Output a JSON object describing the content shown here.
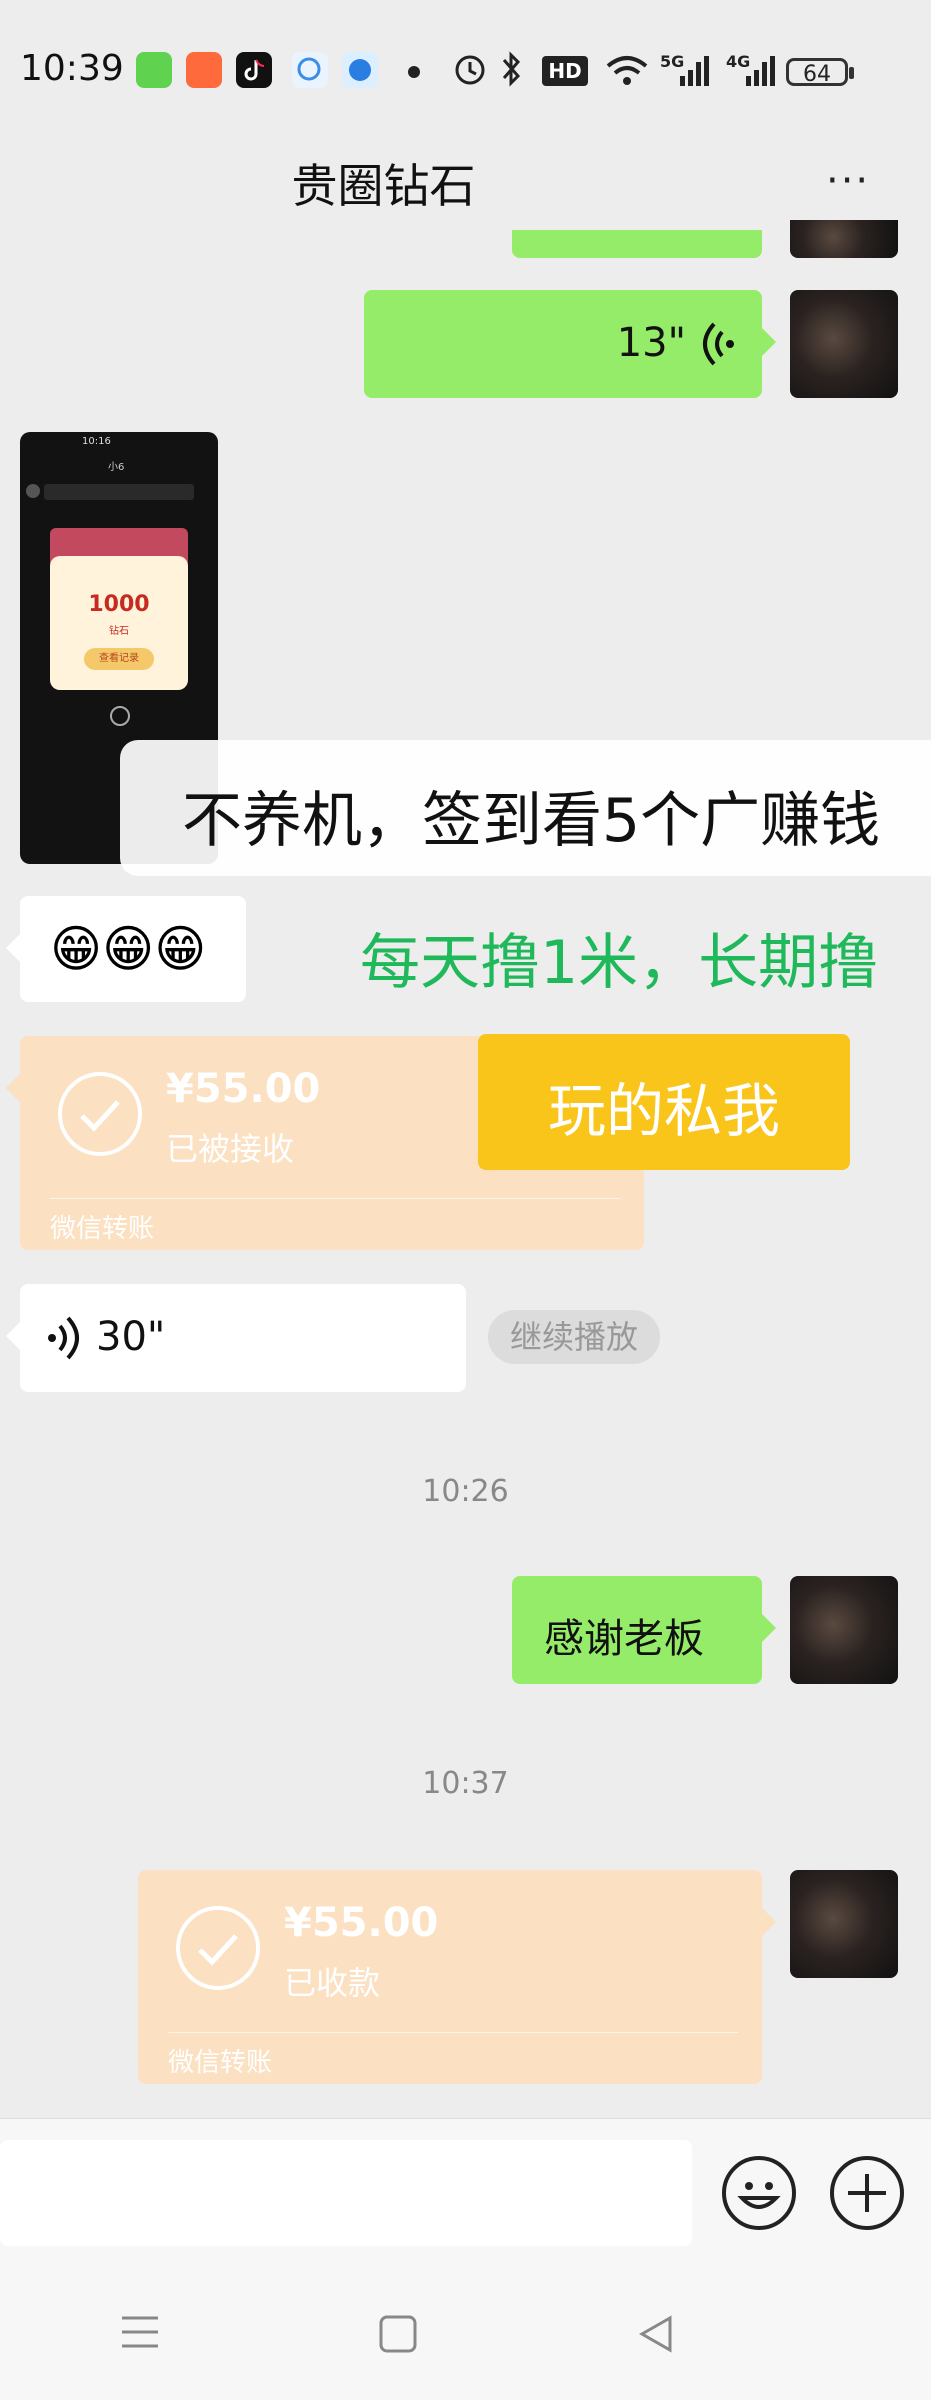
{
  "status_bar": {
    "time": "10:39",
    "battery": "64",
    "hd_label": "HD",
    "net_5g": "5G",
    "net_4g": "4G",
    "icons": [
      "messages-app-icon",
      "shopping-app-icon",
      "tiktok-app-icon",
      "chat-app-icon",
      "browser-app-icon",
      "notification-dot",
      "alarm-icon",
      "bluetooth-icon",
      "hd-voice-icon",
      "wifi-icon",
      "signal-5g-icon",
      "signal-4g-icon",
      "battery-icon"
    ]
  },
  "header": {
    "title": "贵圈钻石",
    "more_label": "···"
  },
  "messages": {
    "voice_sent": {
      "duration": "13\""
    },
    "screenshot_preview": {
      "time": "10:16",
      "top_text": "小6",
      "amount": "1000",
      "unit": "钻石",
      "button": "查看记录"
    },
    "overlay_white": "不养机，签到看5个广赚钱",
    "emoji_message": "😁😁😁",
    "overlay_green": "每天撸1米，长期撸",
    "transfer_received": {
      "amount": "¥55.00",
      "status": "已被接收",
      "footer": "微信转账"
    },
    "overlay_yellow": "玩的私我",
    "voice_received": {
      "duration": "30\"",
      "continue_label": "继续播放"
    },
    "time_1": "10:26",
    "thanks_message": "感谢老板",
    "time_2": "10:37",
    "transfer_sent": {
      "amount": "¥55.00",
      "status": "已收款",
      "footer": "微信转账"
    }
  },
  "input_bar": {
    "placeholder": ""
  },
  "colors": {
    "background": "#ededed",
    "bubble_green": "#95ec69",
    "transfer_orange": "#fbe0c2",
    "overlay_yellow": "#f9c51b",
    "overlay_green_text": "#1fb85a"
  }
}
